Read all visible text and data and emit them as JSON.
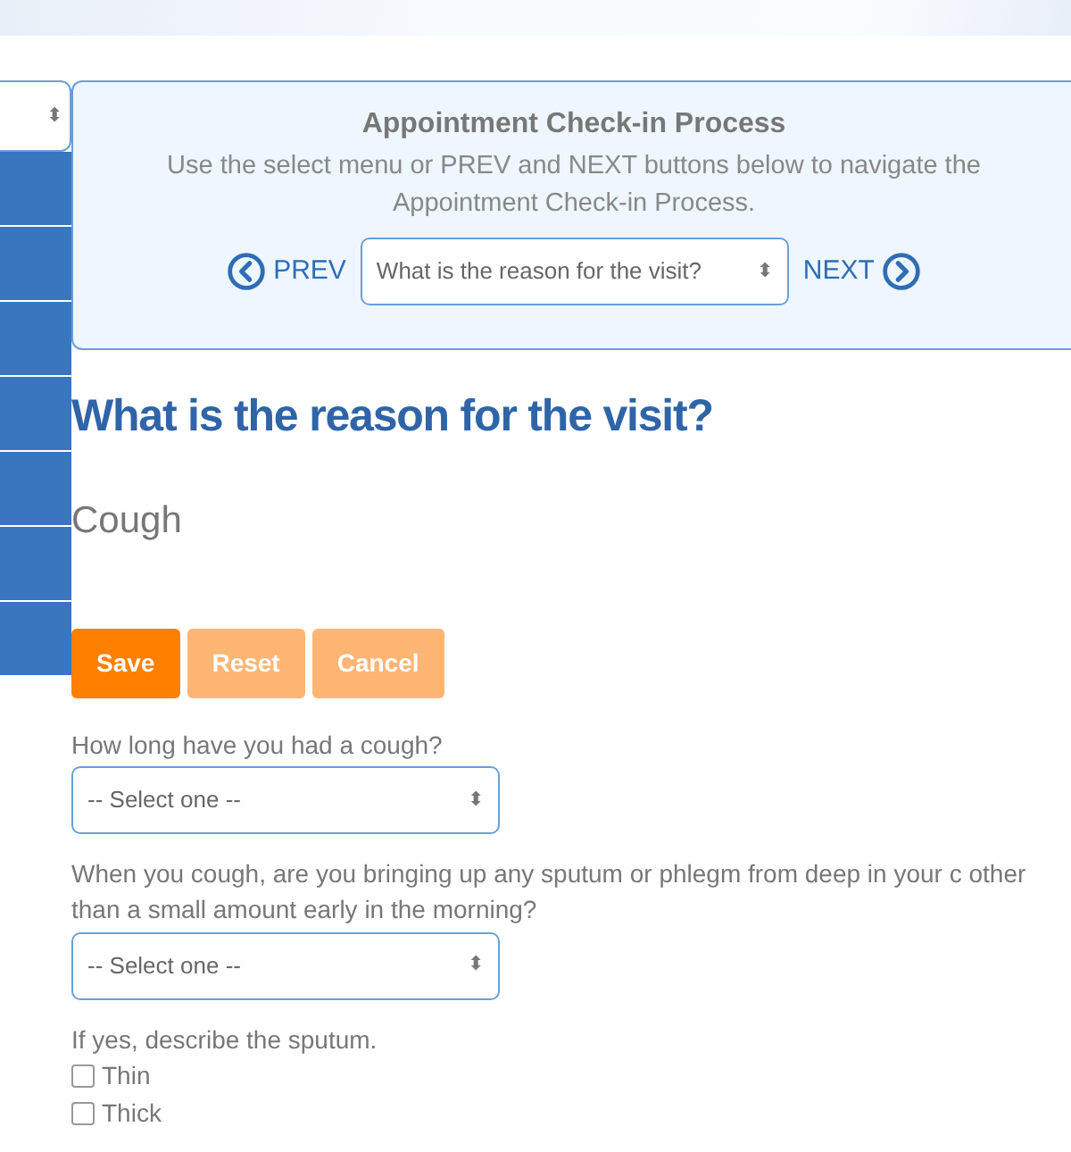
{
  "sidebar": {
    "select_arrows": "⬍",
    "items": [
      {
        "selected": false
      },
      {
        "selected": false
      },
      {
        "selected": false
      },
      {
        "selected": false
      },
      {
        "selected": false
      },
      {
        "selected": false
      },
      {
        "selected": false
      }
    ]
  },
  "process_panel": {
    "title": "Appointment Check-in Process",
    "description": "Use the select menu or PREV and NEXT buttons below to navigate the Appointment Check-in Process.",
    "prev": "PREV",
    "next": "NEXT",
    "step_select": "What is the reason for the visit?"
  },
  "heading": "What is the reason for the visit?",
  "complaint": "Cough",
  "buttons": [
    {
      "label": "Save",
      "disabled": false
    },
    {
      "label": "Reset",
      "disabled": true
    },
    {
      "label": "Cancel",
      "disabled": true
    }
  ],
  "questions": [
    {
      "kind": "select",
      "label": "How long have you had a cough?",
      "value": "-- Select one --"
    },
    {
      "kind": "select",
      "label": "When you cough, are you bringing up any sputum or phlegm from deep in your c other than a small amount early in the morning?",
      "value": "-- Select one --"
    },
    {
      "kind": "checkboxes",
      "label": "If yes, describe the sputum.",
      "options": [
        {
          "label": "Thin",
          "checked": false
        },
        {
          "label": "Thick",
          "checked": false
        }
      ]
    }
  ]
}
